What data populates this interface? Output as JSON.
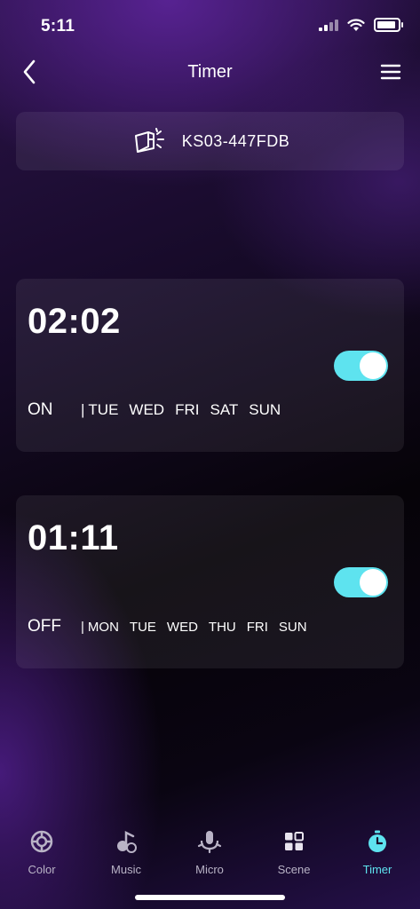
{
  "status": {
    "time": "5:11"
  },
  "header": {
    "title": "Timer"
  },
  "device": {
    "name": "KS03-447FDB"
  },
  "timers": [
    {
      "time": "02:02",
      "action": "ON",
      "separator": "|",
      "days": [
        "TUE",
        "WED",
        "FRI",
        "SAT",
        "SUN"
      ],
      "enabled": true
    },
    {
      "time": "01:11",
      "action": "OFF",
      "separator": "|",
      "days": [
        "MON",
        "TUE",
        "WED",
        "THU",
        "FRI",
        "SUN"
      ],
      "enabled": true
    }
  ],
  "tabs": [
    {
      "label": "Color",
      "icon": "color-wheel-icon"
    },
    {
      "label": "Music",
      "icon": "music-note-icon"
    },
    {
      "label": "Micro",
      "icon": "microphone-icon"
    },
    {
      "label": "Scene",
      "icon": "scene-grid-icon"
    },
    {
      "label": "Timer",
      "icon": "stopwatch-icon",
      "active": true
    }
  ],
  "colors": {
    "accent": "#5ee3ef",
    "inactive_tab": "#b9b3c6"
  }
}
